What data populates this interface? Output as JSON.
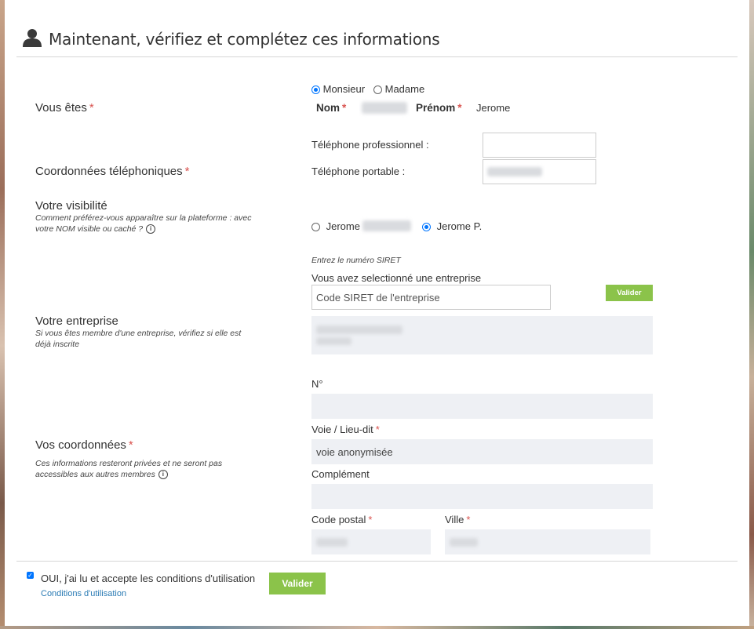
{
  "header": {
    "title": "Maintenant, vérifiez et complétez ces informations",
    "icon": "user-icon"
  },
  "identity": {
    "label": "Vous êtes",
    "required_mark": "*",
    "civility": [
      {
        "label": "Monsieur",
        "selected": true
      },
      {
        "label": "Madame",
        "selected": false
      }
    ],
    "nom_label": "Nom",
    "prenom_label": "Prénom",
    "prenom_value": "Jerome"
  },
  "phones": {
    "label": "Coordonnées téléphoniques",
    "required_mark": "*",
    "pro_label": "Téléphone professionnel :",
    "pro_value": "",
    "mobile_label": "Téléphone portable :"
  },
  "visibility": {
    "label": "Votre visibilité",
    "help": "Comment préférez-vous apparaître sur la plateforme : avec votre NOM visible ou caché ?",
    "info_icon": "ⓘ",
    "option_full": "Jerome",
    "option_short": "Jerome P.",
    "selected": "short"
  },
  "company": {
    "label": "Votre entreprise",
    "help": "Si vous êtes membre d'une entreprise, vérifiez si elle est déjà inscrite",
    "siret_hint": "Entrez le numéro SIRET",
    "selected_text": "Vous avez selectionné une entreprise",
    "siret_placeholder": "Code SIRET de l'entreprise",
    "validate_label": "Valider"
  },
  "address": {
    "label": "Vos coordonnées",
    "required_mark": "*",
    "help": "Ces informations resteront privées et ne seront pas accessibles aux autres membres",
    "numero_label": "N°",
    "numero_value": "",
    "voie_label": "Voie / Lieu-dit",
    "voie_value": "voie anonymisée",
    "complement_label": "Complément",
    "complement_value": "",
    "cp_label": "Code postal",
    "ville_label": "Ville"
  },
  "footer": {
    "accept_text": "OUI, j'ai lu et accepte les conditions d'utilisation",
    "accepted": true,
    "conditions_link": "Conditions d'utilisation",
    "submit_label": "Valider"
  },
  "colors": {
    "accent_green": "#8bc34a",
    "required_red": "#d9534f",
    "link_blue": "#2a7bb4",
    "radio_blue": "#0075ff"
  }
}
